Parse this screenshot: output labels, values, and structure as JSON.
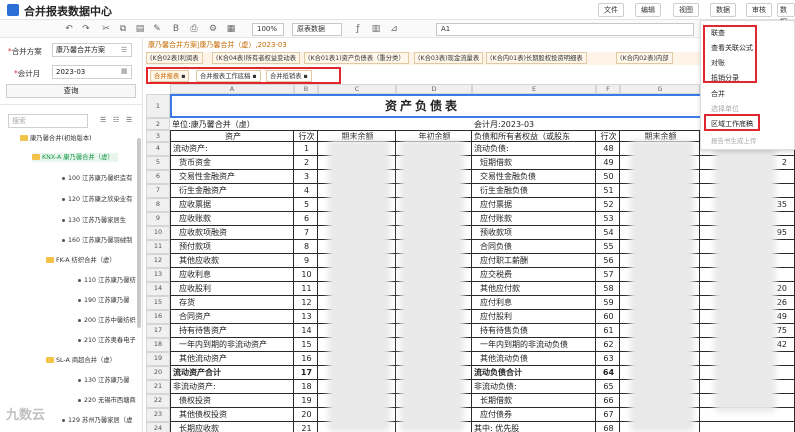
{
  "app": {
    "title": "合并报表数据中心"
  },
  "topmenu": [
    "文件",
    "编辑",
    "视图",
    "数据",
    "审核",
    "数据"
  ],
  "toolbar": {
    "zoom": "100%",
    "view_select": "原表数据",
    "cell_ref": "A1"
  },
  "left": {
    "scheme_label": "合并方案",
    "scheme_value": "康乃馨合并方案",
    "period_label": "会计月",
    "period_value": "2023-03",
    "query_label": "查询",
    "search_placeholder": "搜索",
    "tree": [
      "康乃馨合并(初始版本)",
      "KNX-A 康乃馨合并（虚）",
      "100 江苏康乃馨织造有",
      "120 江苏康之欣染业有",
      "130 江苏乃馨家居生",
      "160 江苏康乃馨羽绒制",
      "FK-A 纺织合并（虚）",
      "110 江苏康乃馨纺",
      "190 江苏康乃馨",
      "200 江苏中馨纺织",
      "210 江苏奥春电子",
      "SL-A 商超合并（虚）",
      "130 江苏康乃馨",
      "220 无锡市西塘商",
      "129 苏州乃馨家居（虚"
    ]
  },
  "tabs": {
    "header": "康乃馨合并方案|康乃馨合并（虚）,2023-03",
    "row1": [
      "(K合02表)利润表",
      "(K合04表)所有者权益变动表",
      "(K合01表1)资产负债表（重分类）",
      "(K合03表)现金流量表",
      "(K合内01表)长期股权投资明细表",
      "(K合内02表)内部"
    ],
    "row2": [
      "合并报表",
      "合并报表工作底稿",
      "合并抵销表"
    ]
  },
  "sheet": {
    "columns": [
      "A",
      "B",
      "C",
      "D",
      "E",
      "F",
      "G"
    ],
    "title": "资产负债表",
    "unit": "单位:康乃馨合并（虚）",
    "period": "会计月:2023-03",
    "headers": [
      "资产",
      "行次",
      "期末余额",
      "年初余额",
      "负债和所有者权益（或股东",
      "行次",
      "期末余额"
    ],
    "rows": [
      {
        "n": "4",
        "a": "流动资产:",
        "b": "1",
        "e": "流动负债:",
        "f": "48"
      },
      {
        "n": "5",
        "a": "货币资金",
        "b": "2",
        "e": "短期借款",
        "f": "49"
      },
      {
        "n": "6",
        "a": "交易性金融资产",
        "b": "3",
        "e": "交易性金融负债",
        "f": "50"
      },
      {
        "n": "7",
        "a": "衍生金融资产",
        "b": "4",
        "e": "衍生金融负债",
        "f": "51"
      },
      {
        "n": "8",
        "a": "应收票据",
        "b": "5",
        "e": "应付票据",
        "f": "52"
      },
      {
        "n": "9",
        "a": "应收账款",
        "b": "6",
        "e": "应付账款",
        "f": "53"
      },
      {
        "n": "10",
        "a": "应收款项融资",
        "b": "7",
        "e": "预收款项",
        "f": "54"
      },
      {
        "n": "11",
        "a": "预付款项",
        "b": "8",
        "e": "合同负债",
        "f": "55"
      },
      {
        "n": "12",
        "a": "其他应收款",
        "b": "9",
        "e": "应付职工薪酬",
        "f": "56"
      },
      {
        "n": "13",
        "a": "应收利息",
        "b": "10",
        "e": "应交税费",
        "f": "57"
      },
      {
        "n": "14",
        "a": "应收股利",
        "b": "11",
        "e": "其他应付款",
        "f": "58"
      },
      {
        "n": "15",
        "a": "存货",
        "b": "12",
        "e": "应付利息",
        "f": "59"
      },
      {
        "n": "16",
        "a": "合同资产",
        "b": "13",
        "e": "应付股利",
        "f": "60"
      },
      {
        "n": "17",
        "a": "持有待售资产",
        "b": "14",
        "e": "持有待售负债",
        "f": "61"
      },
      {
        "n": "18",
        "a": "一年内到期的非流动资产",
        "b": "15",
        "e": "一年内到期的非流动负债",
        "f": "62"
      },
      {
        "n": "19",
        "a": "其他流动资产",
        "b": "16",
        "e": "其他流动负债",
        "f": "63"
      },
      {
        "n": "20",
        "a": "流动资产合计",
        "b": "17",
        "e": "流动负债合计",
        "f": "64"
      },
      {
        "n": "21",
        "a": "非流动资产:",
        "b": "18",
        "e": "非流动负债:",
        "f": "65"
      },
      {
        "n": "22",
        "a": "债权投资",
        "b": "19",
        "e": "长期借款",
        "f": "66"
      },
      {
        "n": "23",
        "a": "其他债权投资",
        "b": "20",
        "e": "应付债券",
        "f": "67"
      },
      {
        "n": "24",
        "a": "长期应收款",
        "b": "21",
        "e": "其中: 优先股",
        "f": "68"
      },
      {
        "n": "25",
        "a": "长期股权投资",
        "b": "22",
        "c": "31,489,290.00",
        "d": "41,129,081.20",
        "e": "永续债",
        "f": "69"
      }
    ],
    "partial_values": [
      "2",
      "35",
      "95",
      "20",
      "26",
      "49",
      "75",
      "42"
    ]
  },
  "context_menu": [
    "联查",
    "查看关联公式",
    "对账",
    "抵销分录",
    "合并",
    "选择单位",
    "区域工作底稿",
    "报告书生成上传"
  ],
  "watermark": "九数云"
}
